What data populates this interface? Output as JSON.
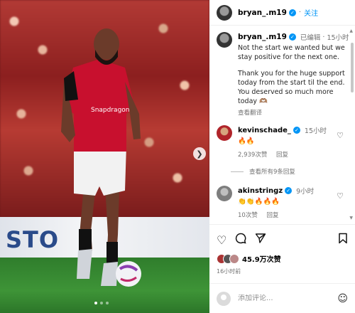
{
  "post": {
    "username": "bryan_.m19",
    "follow_label": "关注"
  },
  "caption": {
    "username": "bryan_.m19",
    "edited": "已编辑",
    "dot": "·",
    "time": "15小时",
    "text_p1": "Not the start we wanted but we stay positive for the next one.",
    "text_p2": "Thank you for the huge support today from the start til the end. You deserved so much more today 🫶🏽",
    "translate": "查看翻译"
  },
  "comments": [
    {
      "username": "kevinschade_",
      "time": "15小时",
      "text": "🔥🔥",
      "likes": "2,939次赞",
      "reply": "回复",
      "replies": "查看所有9条回复"
    },
    {
      "username": "akinstringz",
      "time": "9小时",
      "text": "👏👏🔥🔥🔥",
      "likes": "10次赞",
      "reply": "回复"
    }
  ],
  "likes": {
    "count": "45.9万次赞",
    "time": "16小时前"
  },
  "comment_box": {
    "placeholder": "添加评论..."
  },
  "photo": {
    "sponsor_text": "Snapdragon",
    "board_text": "STO"
  },
  "icons": {
    "like": "heart-icon",
    "comment": "comment-icon",
    "share": "share-icon",
    "save": "bookmark-icon",
    "verified": "verified-badge-icon",
    "emoji": "emoji-icon",
    "next": "chevron-right-icon"
  },
  "colors": {
    "accent": "#0095f6",
    "muted": "#737373",
    "kit_red": "#c8102e"
  }
}
